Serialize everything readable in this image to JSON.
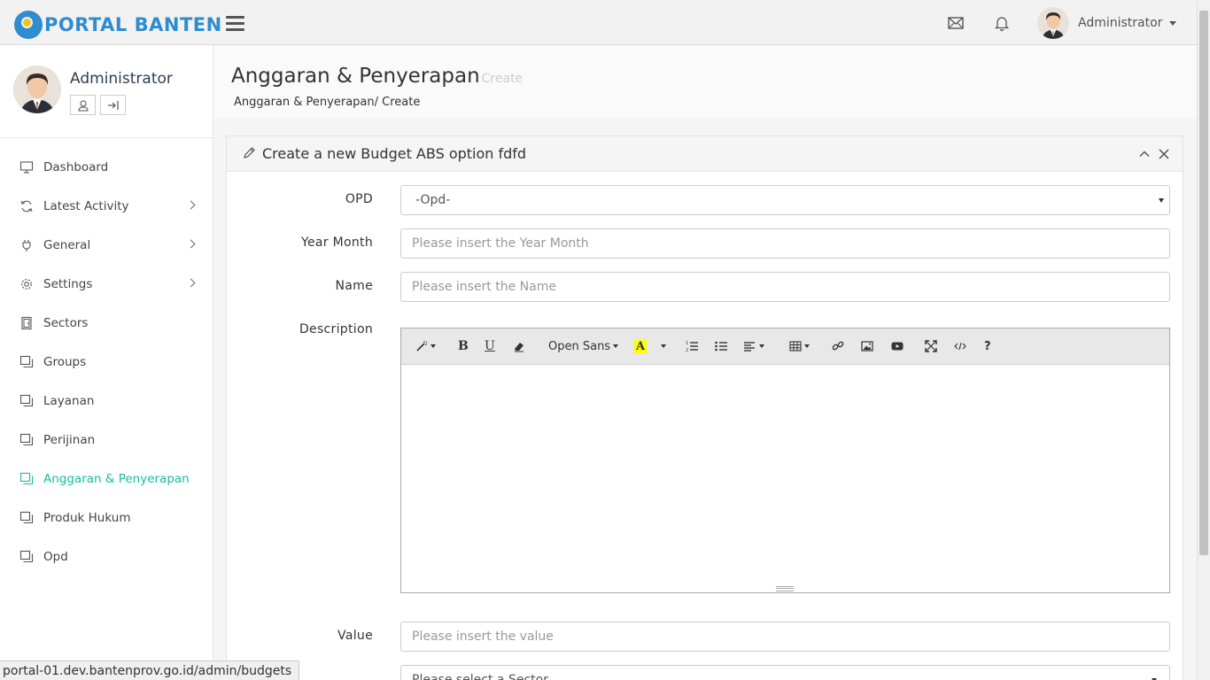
{
  "brand": {
    "name": "PORTAL BANTEN"
  },
  "navbar": {
    "user_name": "Administrator"
  },
  "sidebar": {
    "profile_name": "Administrator",
    "items": [
      {
        "label": "Dashboard",
        "icon": "monitor-icon",
        "has_submenu": false,
        "active": false
      },
      {
        "label": "Latest Activity",
        "icon": "refresh-icon",
        "has_submenu": true,
        "active": false
      },
      {
        "label": "General",
        "icon": "plug-icon",
        "has_submenu": true,
        "active": false
      },
      {
        "label": "Settings",
        "icon": "gear-icon",
        "has_submenu": true,
        "active": false
      },
      {
        "label": "Sectors",
        "icon": "door-icon",
        "has_submenu": false,
        "active": false
      },
      {
        "label": "Groups",
        "icon": "windows-icon",
        "has_submenu": false,
        "active": false
      },
      {
        "label": "Layanan",
        "icon": "windows-icon",
        "has_submenu": false,
        "active": false
      },
      {
        "label": "Perijinan",
        "icon": "windows-icon",
        "has_submenu": false,
        "active": false
      },
      {
        "label": "Anggaran & Penyerapan",
        "icon": "windows-icon",
        "has_submenu": false,
        "active": true
      },
      {
        "label": "Produk Hukum",
        "icon": "windows-icon",
        "has_submenu": false,
        "active": false
      },
      {
        "label": "Opd",
        "icon": "windows-icon",
        "has_submenu": false,
        "active": false
      }
    ]
  },
  "page": {
    "title": "Anggaran & Penyerapan",
    "subtitle": "Create",
    "breadcrumb": "Anggaran & Penyerapan/ Create"
  },
  "panel": {
    "title": "Create a new Budget ABS option fdfd"
  },
  "form": {
    "opd_label": "OPD",
    "opd_value": "-Opd-",
    "year_month_label": "Year Month",
    "year_month_placeholder": "Please insert the Year Month",
    "name_label": "Name",
    "name_placeholder": "Please insert the Name",
    "description_label": "Description",
    "font_name": "Open Sans",
    "value_label": "Value",
    "value_placeholder": "Please insert the value",
    "sector_placeholder": "Please select a Sector"
  },
  "status_url": "portal-01.dev.bantenprov.go.id/admin/budgets",
  "colors": {
    "brand": "#2e8ccf",
    "active": "#1abc9c"
  }
}
